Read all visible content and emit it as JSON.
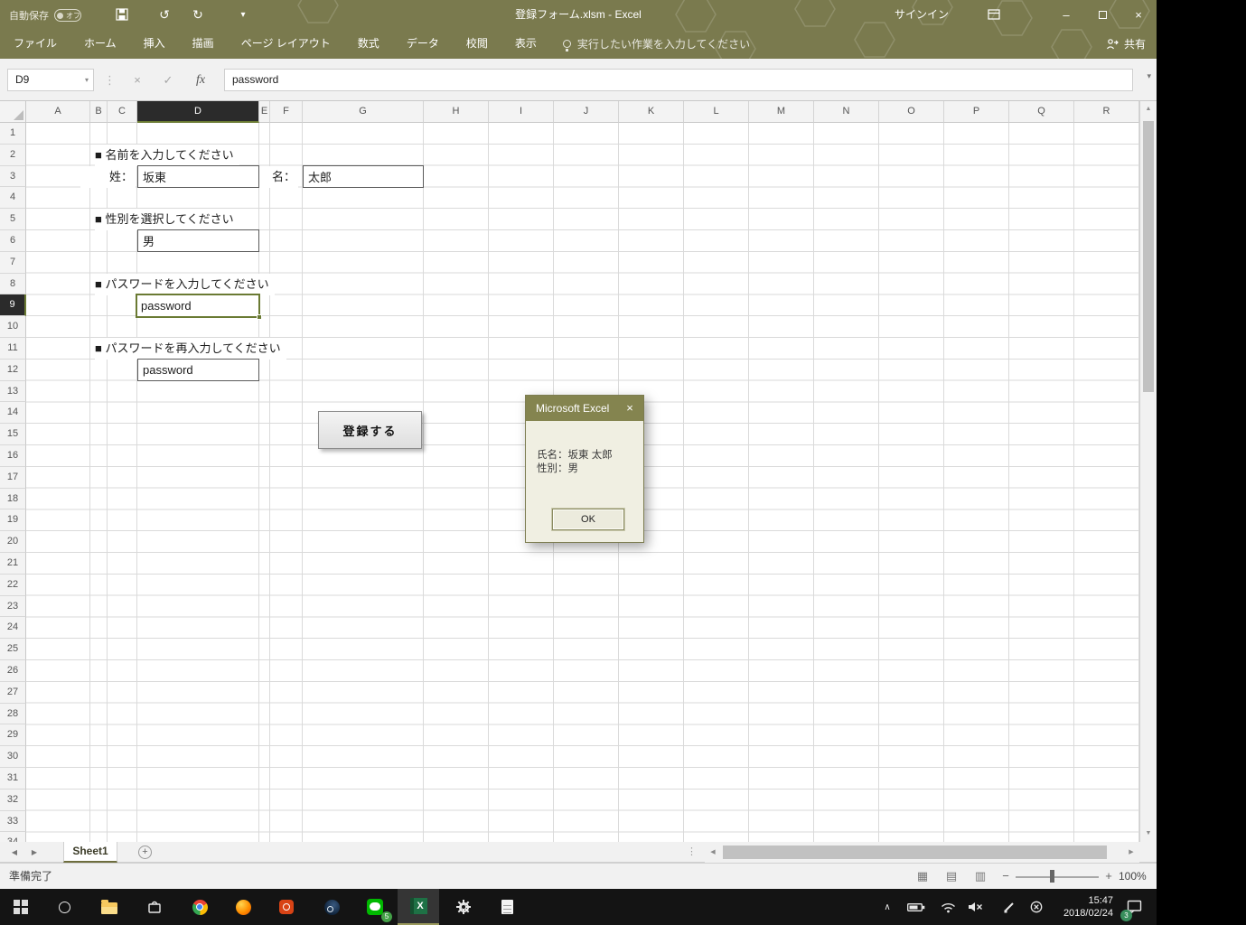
{
  "titlebar": {
    "autosave_label": "自動保存",
    "autosave_state": "オフ",
    "title": "登録フォーム.xlsm  -  Excel",
    "signin": "サインイン"
  },
  "ribbon": {
    "tabs": [
      "ファイル",
      "ホーム",
      "挿入",
      "描画",
      "ページ レイアウト",
      "数式",
      "データ",
      "校閲",
      "表示"
    ],
    "tellme_placeholder": "実行したい作業を入力してください",
    "share_label": "共有"
  },
  "formula_bar": {
    "name_box": "D9",
    "fx_label": "fx",
    "value": "password"
  },
  "grid": {
    "columns": [
      "A",
      "B",
      "C",
      "D",
      "E",
      "F",
      "G",
      "H",
      "I",
      "J",
      "K",
      "L",
      "M",
      "N",
      "O",
      "P",
      "Q",
      "R"
    ],
    "visible_rows": 34,
    "selected_column": "D",
    "selected_row": 9
  },
  "form": {
    "name_section": "■ 名前を入力してください",
    "last_name_label": "姓：",
    "last_name_value": "坂東",
    "first_name_label": "名：",
    "first_name_value": "太郎",
    "gender_section": "■ 性別を選択してください",
    "gender_value": "男",
    "password_section": "■ パスワードを入力してください",
    "password_value": "password",
    "password_confirm_section": "■ パスワードを再入力してください",
    "password_confirm_value": "password",
    "register_button": "登録する"
  },
  "dialog": {
    "title": "Microsoft Excel",
    "message_line1": "氏名：坂東 太郎",
    "message_line2": "性別：男",
    "ok_label": "OK"
  },
  "sheet_tabs": {
    "active_tab": "Sheet1"
  },
  "status_bar": {
    "ready": "準備完了",
    "zoom_label": "100%"
  },
  "taskbar": {
    "time": "15:47",
    "date": "2018/02/24",
    "line_badge": "5",
    "notification_badge": "3"
  },
  "glyphs": {
    "undo": "↺",
    "redo": "↻",
    "qat_dropdown": "▾",
    "minimize": "–",
    "close": "×",
    "namebox_caret": "▾",
    "separator_dots": "⋮",
    "cancel": "×",
    "enter": "✓",
    "formula_expand": "▾",
    "tab_prev": "◀",
    "tab_next": "▶",
    "add_sheet": "+",
    "hscroll_left": "◀",
    "hscroll_right": "▶",
    "vscroll_up": "▲",
    "vscroll_down": "▼",
    "view_normal": "▦",
    "view_layout": "▤",
    "view_break": "▥",
    "zoom_out": "−",
    "zoom_in": "+",
    "tray_chevron": "∧",
    "dialog_close": "×",
    "excel_x": "X"
  },
  "colors": {
    "titlebar_olive": "#7a7a4e",
    "dialog_title_olive": "#84844f",
    "selection_green": "#6a7a33",
    "excel_icon_green": "#1e7145",
    "badge_green": "#43a047"
  }
}
